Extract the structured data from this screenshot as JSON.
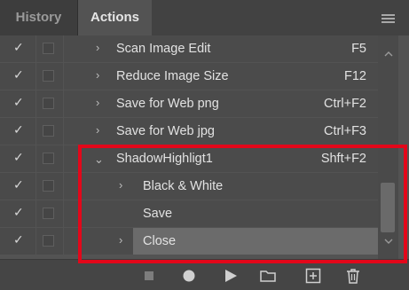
{
  "tabs": {
    "history": "History",
    "actions": "Actions"
  },
  "rows": [
    {
      "check": "✓",
      "arrow": "›",
      "name": "Scan Image Edit",
      "shortcut": "F5"
    },
    {
      "check": "✓",
      "arrow": "›",
      "name": "Reduce Image Size",
      "shortcut": "F12"
    },
    {
      "check": "✓",
      "arrow": "›",
      "name": "Save for Web png",
      "shortcut": "Ctrl+F2"
    },
    {
      "check": "✓",
      "arrow": "›",
      "name": "Save for Web jpg",
      "shortcut": "Ctrl+F3"
    },
    {
      "check": "✓",
      "arrow": "⌄",
      "name": "ShadowHighligt1",
      "shortcut": "Shft+F2"
    },
    {
      "check": "✓",
      "arrow": "›",
      "name": "Black & White",
      "shortcut": ""
    },
    {
      "check": "✓",
      "arrow": "",
      "name": "Save",
      "shortcut": ""
    },
    {
      "check": "✓",
      "arrow": "›",
      "name": "Close",
      "shortcut": ""
    }
  ],
  "icons": {
    "menu": "panel-menu-icon",
    "stop": "stop-icon",
    "record": "record-icon",
    "play": "play-icon",
    "folder": "new-set-folder-icon",
    "new": "new-action-icon",
    "trash": "delete-trash-icon"
  },
  "colors": {
    "highlight": "#e3071a",
    "selected_row": "#6b6b6b"
  }
}
